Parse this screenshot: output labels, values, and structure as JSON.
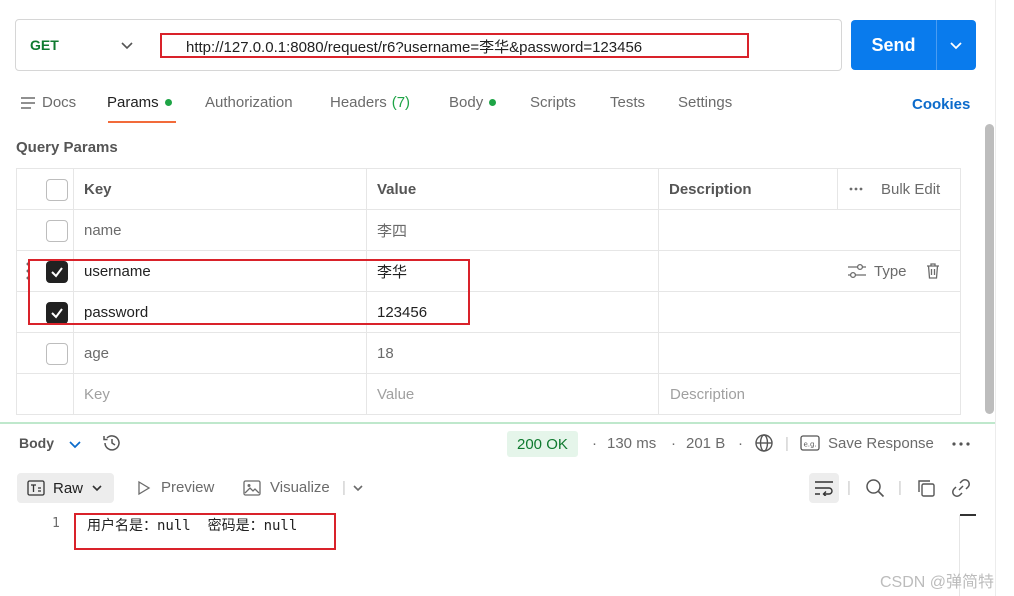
{
  "request": {
    "method": "GET",
    "url": "http://127.0.0.1:8080/request/r6?username=李华&password=123456",
    "send_label": "Send"
  },
  "tabs": [
    {
      "label": "Docs"
    },
    {
      "label": "Params"
    },
    {
      "label": "Authorization"
    },
    {
      "label": "Headers",
      "count": "(7)"
    },
    {
      "label": "Body"
    },
    {
      "label": "Scripts"
    },
    {
      "label": "Tests"
    },
    {
      "label": "Settings"
    }
  ],
  "cookies_label": "Cookies",
  "query_params": {
    "title": "Query Params",
    "headers": {
      "key": "Key",
      "value": "Value",
      "description": "Description",
      "bulk_edit": "Bulk Edit"
    },
    "rows": [
      {
        "key": "name",
        "value": "李四",
        "checked": false
      },
      {
        "key": "username",
        "value": "李华",
        "checked": true
      },
      {
        "key": "password",
        "value": "123456",
        "checked": true
      },
      {
        "key": "age",
        "value": "18",
        "checked": false
      }
    ],
    "placeholders": {
      "key": "Key",
      "value": "Value",
      "description": "Description"
    },
    "row_action_type": "Type"
  },
  "response": {
    "body_label": "Body",
    "status": "200 OK",
    "time": "130 ms",
    "size": "201 B",
    "save_response": "Save Response",
    "format": "Raw",
    "preview": "Preview",
    "visualize": "Visualize",
    "line_number": "1",
    "body_text": "用户名是：null  密码是：null"
  },
  "watermark": "CSDN @弹简特",
  "colors": {
    "send": "#097bed",
    "method": "#0f7a2f",
    "status_ok": "#0f7a2f",
    "highlight": "#d9222a",
    "tab_underline": "#f26b3a"
  }
}
